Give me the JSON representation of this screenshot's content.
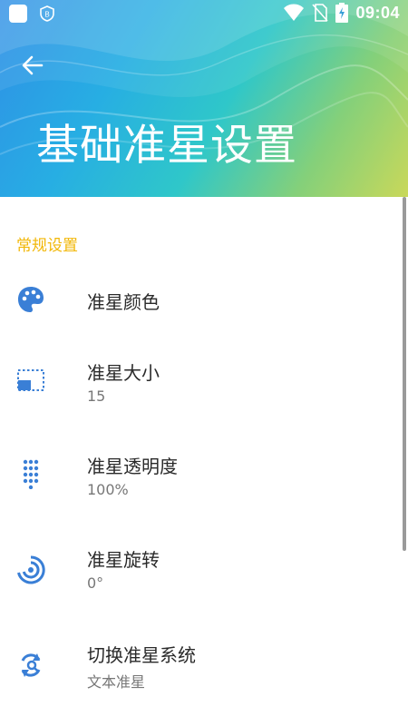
{
  "status_bar": {
    "time": "09:04"
  },
  "header": {
    "title": "基础准星设置"
  },
  "section": {
    "label": "常规设置"
  },
  "prefs": [
    {
      "title": "准星颜色",
      "summary": "",
      "icon": "palette-icon"
    },
    {
      "title": "准星大小",
      "summary": "15",
      "icon": "crop-size-icon"
    },
    {
      "title": "准星透明度",
      "summary": "100%",
      "icon": "dotted-grid-icon"
    },
    {
      "title": "准星旋转",
      "summary": "0°",
      "icon": "rotation-target-icon"
    },
    {
      "title": "切换准星系统",
      "summary": "文本准星",
      "icon": "switch-refresh-icon"
    }
  ],
  "colors": {
    "accent": "#f2b707",
    "icon": "#3a7fd6",
    "text": "#2a2a2a",
    "summary": "#777777"
  }
}
